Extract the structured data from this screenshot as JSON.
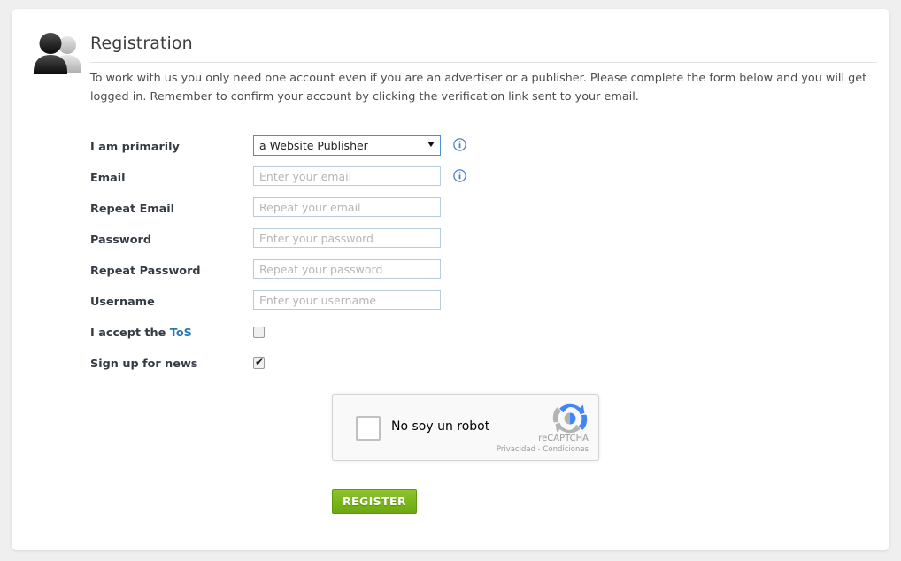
{
  "page": {
    "background_color": "#efefef",
    "card_color": "#ffffff"
  },
  "header": {
    "icon": "users-icon",
    "title": "Registration",
    "intro": "To work with us you only need one account even if you are an advertiser or a publisher. Please complete the form below and you will get logged in. Remember to confirm your account by clicking the verification link sent to your email."
  },
  "form": {
    "rows": [
      {
        "label": "I am primarily",
        "type": "select",
        "value": "a Website Publisher",
        "info_icon": true
      },
      {
        "label": "Email",
        "type": "text",
        "value": "",
        "placeholder": "Enter your email",
        "info_icon": true
      },
      {
        "label": "Repeat Email",
        "type": "text",
        "value": "",
        "placeholder": "Repeat your email",
        "info_icon": false
      },
      {
        "label": "Password",
        "type": "password",
        "value": "",
        "placeholder": "Enter your password",
        "info_icon": false
      },
      {
        "label": "Repeat Password",
        "type": "password",
        "value": "",
        "placeholder": "Repeat your password",
        "info_icon": false
      },
      {
        "label": "Username",
        "type": "text",
        "value": "",
        "placeholder": "Enter your username",
        "info_icon": false
      }
    ],
    "tos": {
      "label_prefix": "I accept the ",
      "link_text": "ToS",
      "checked": false
    },
    "newsletter": {
      "label": "Sign up for news",
      "checked": true
    },
    "select_options": [
      "a Website Publisher"
    ]
  },
  "recaptcha": {
    "checkbox_label": "No soy un robot",
    "brand": "reCAPTCHA",
    "legal": "Privacidad - Condiciones",
    "checked": false,
    "logo_icon": "recaptcha-logo-icon"
  },
  "submit": {
    "label": "REGISTER",
    "color": "#75b617"
  },
  "colors": {
    "link": "#2a7ab0",
    "label": "#333b44",
    "placeholder": "#b6b6b6",
    "input_border": "#b8cdd9",
    "select_border": "#4a90d9",
    "info_icon": "#4a7fc1",
    "divider": "#e3e3e3"
  }
}
